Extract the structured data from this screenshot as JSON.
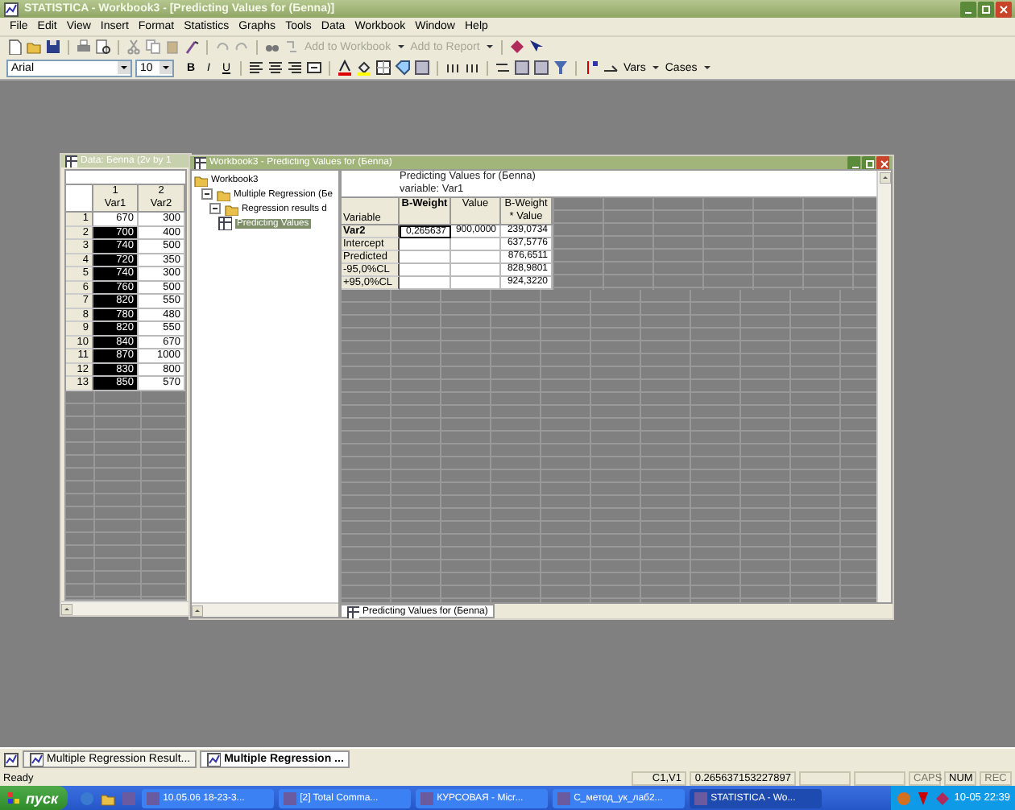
{
  "app": {
    "title": "STATISTICA - Workbook3 - [Predicting Values for (Бenna)]"
  },
  "menu": [
    "File",
    "Edit",
    "View",
    "Insert",
    "Format",
    "Statistics",
    "Graphs",
    "Tools",
    "Data",
    "Workbook",
    "Window",
    "Help"
  ],
  "toolbar": {
    "add_workbook": "Add to Workbook",
    "add_report": "Add to Report"
  },
  "format_bar": {
    "font": "Arial",
    "size": "10",
    "bold": "B",
    "italic": "I",
    "underline": "U",
    "vars": "Vars",
    "cases": "Cases"
  },
  "data_window": {
    "title": "Data: Бenna (2v by 1",
    "columns": [
      {
        "number": "1",
        "name": "Var1"
      },
      {
        "number": "2",
        "name": "Var2"
      }
    ],
    "rows": [
      {
        "label": "1",
        "cells": [
          "670",
          "300"
        ],
        "selected": false
      },
      {
        "label": "2",
        "cells": [
          "700",
          "400"
        ],
        "selected": true
      },
      {
        "label": "3",
        "cells": [
          "740",
          "500"
        ],
        "selected": true
      },
      {
        "label": "4",
        "cells": [
          "720",
          "350"
        ],
        "selected": true
      },
      {
        "label": "5",
        "cells": [
          "740",
          "300"
        ],
        "selected": true
      },
      {
        "label": "6",
        "cells": [
          "760",
          "500"
        ],
        "selected": true
      },
      {
        "label": "7",
        "cells": [
          "820",
          "550"
        ],
        "selected": true
      },
      {
        "label": "8",
        "cells": [
          "780",
          "480"
        ],
        "selected": true
      },
      {
        "label": "9",
        "cells": [
          "820",
          "550"
        ],
        "selected": true
      },
      {
        "label": "10",
        "cells": [
          "840",
          "670"
        ],
        "selected": true
      },
      {
        "label": "11",
        "cells": [
          "870",
          "1000"
        ],
        "selected": true
      },
      {
        "label": "12",
        "cells": [
          "830",
          "800"
        ],
        "selected": true
      },
      {
        "label": "13",
        "cells": [
          "850",
          "570"
        ],
        "selected": true
      }
    ]
  },
  "workbook": {
    "title": "Workbook3 - Predicting Values for (Бenna)",
    "tree": [
      {
        "label": "Workbook3",
        "kind": "workbook",
        "selected": false,
        "children": [
          {
            "label": "Multiple Regression (Бe",
            "kind": "folder",
            "expanded": true,
            "selected": false,
            "children": [
              {
                "label": "Regression results d",
                "kind": "folder",
                "expanded": true,
                "selected": false,
                "children": [
                  {
                    "label": "Predicting Values",
                    "kind": "sheet",
                    "selected": true
                  }
                ]
              }
            ]
          }
        ]
      }
    ],
    "sheet": {
      "header_lines": [
        "Predicting Values for (Бenna)",
        "variable: Var1"
      ],
      "corner": "Variable",
      "columns": [
        "B-Weight",
        "Value",
        "B-Weight\n* Value"
      ],
      "rows": [
        {
          "label": "Var2",
          "kind": "variable",
          "cells": [
            "0,265637",
            "900,0000",
            "239,0734"
          ],
          "current": true
        },
        {
          "label": "Intercept",
          "kind": "statistic",
          "cells": [
            "",
            "",
            "637,5776"
          ],
          "current": false
        },
        {
          "label": "Predicted",
          "kind": "statistic",
          "cells": [
            "",
            "",
            "876,6511"
          ],
          "current": false
        },
        {
          "label": "-95,0%CL",
          "kind": "statistic",
          "cells": [
            "",
            "",
            "828,9801"
          ],
          "current": false
        },
        {
          "label": "+95,0%CL",
          "kind": "statistic",
          "cells": [
            "",
            "",
            "924,3220"
          ],
          "current": false
        }
      ]
    },
    "tab": "Predicting Values for (Бenna)"
  },
  "report_tabs": [
    {
      "label": "Multiple Regression Result...",
      "selected": false
    },
    {
      "label": "Multiple Regression ...",
      "selected": true
    }
  ],
  "status_bar": {
    "message": "Ready",
    "cell": "C1,V1",
    "value": "0.265637153227897",
    "indicators": [
      {
        "label": "CAPS",
        "on": false
      },
      {
        "label": "NUM",
        "on": true
      },
      {
        "label": "REC",
        "on": false
      }
    ]
  },
  "taskbar": {
    "start": "пуск",
    "tasks": [
      {
        "label": "10.05.06 18-23-3...",
        "selected": false
      },
      {
        "label": "[2] Total Comma...",
        "selected": false
      },
      {
        "label": "КУРСОВАЯ - Micr...",
        "selected": false
      },
      {
        "label": "С_метод_ук_лаб2...",
        "selected": false
      },
      {
        "label": "STATISTICA - Wo...",
        "selected": true
      }
    ],
    "clock": "10-05 22:39"
  }
}
